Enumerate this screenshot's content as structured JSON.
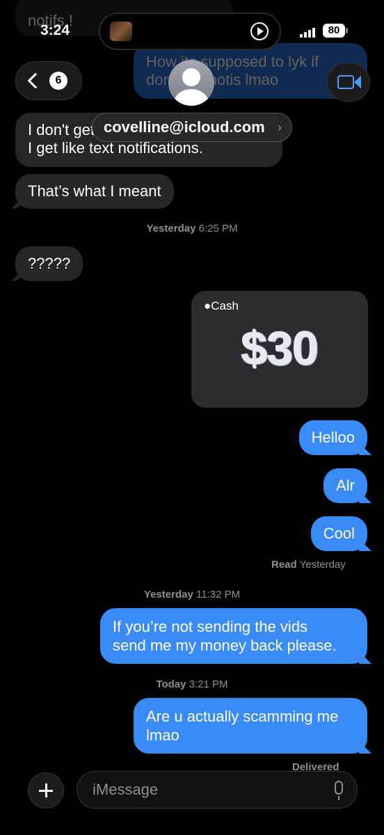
{
  "status": {
    "time": "3:24",
    "battery": "80"
  },
  "nav": {
    "back_count": "6",
    "contact": "covelline@icloud.com",
    "contact_chevron": "›"
  },
  "faded": {
    "top_in": "notifs !",
    "top_out_1": "How its supposed to lyk if",
    "top_out_2": "don't get notis lmao"
  },
  "messages": {
    "m1_line1": "I don't get",
    "m1_line2": "I get like text notifications.",
    "m2": "That’s what I meant",
    "stamp1_day": "Yesterday",
    "stamp1_time": "6:25 PM",
    "m3": "?????",
    "cash_label": "Cash",
    "cash_amount": "$30",
    "m4": "Helloo",
    "m5": "Alr",
    "m6": "Cool",
    "read_label": "Read",
    "read_when": "Yesterday",
    "stamp2_day": "Yesterday",
    "stamp2_time": "11:32 PM",
    "m7_line1": "If you’re not sending the vids",
    "m7_line2": "send me my money back please.",
    "stamp3_day": "Today",
    "stamp3_time": "3:21 PM",
    "m8_line1": "Are u actually scamming me",
    "m8_line2": "lmao",
    "delivered": "Delivered"
  },
  "input": {
    "placeholder": "iMessage"
  },
  "colors": {
    "outgoing": "#3b8bf7",
    "incoming": "#262628",
    "background": "#000000"
  }
}
